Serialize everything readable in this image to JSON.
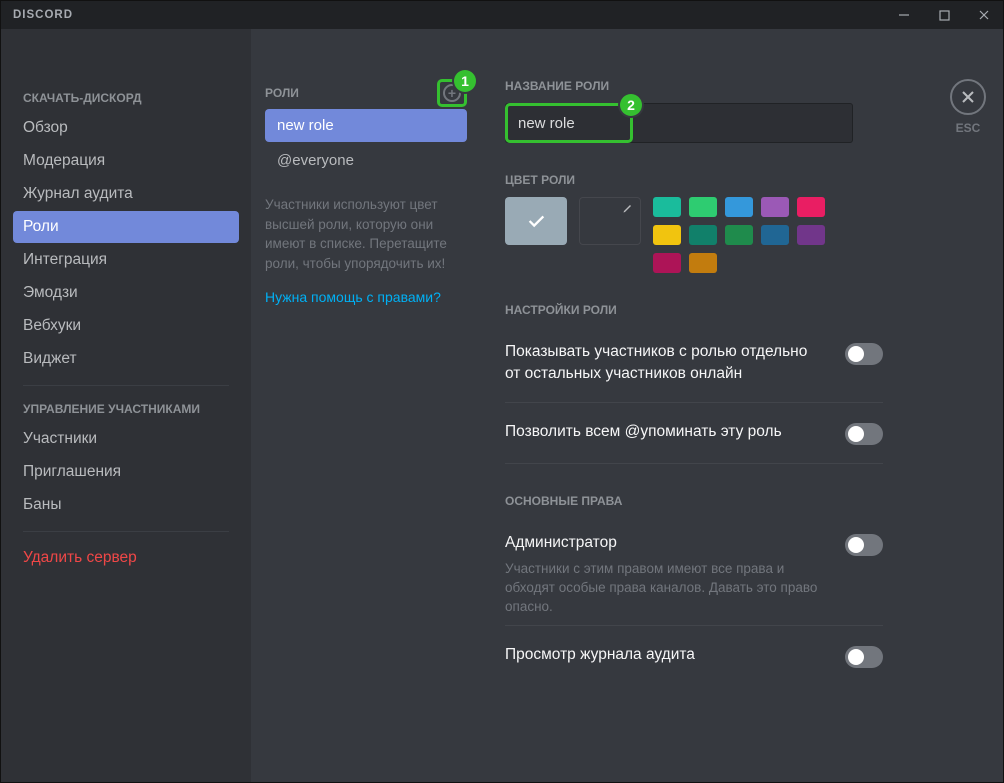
{
  "app": {
    "title": "DISCORD"
  },
  "annotations": {
    "badge1": "1",
    "badge2": "2"
  },
  "close": {
    "esc": "ESC"
  },
  "sidebar": {
    "section1": "СКАЧАТЬ-ДИСКОРД",
    "items1": [
      {
        "label": "Обзор"
      },
      {
        "label": "Модерация"
      },
      {
        "label": "Журнал аудита"
      },
      {
        "label": "Роли",
        "selected": true
      },
      {
        "label": "Интеграция"
      },
      {
        "label": "Эмодзи"
      },
      {
        "label": "Вебхуки"
      },
      {
        "label": "Виджет"
      }
    ],
    "section2": "УПРАВЛЕНИЕ УЧАСТНИКАМИ",
    "items2": [
      {
        "label": "Участники"
      },
      {
        "label": "Приглашения"
      },
      {
        "label": "Баны"
      }
    ],
    "delete": "Удалить сервер"
  },
  "roles": {
    "header": "РОЛИ",
    "list": [
      {
        "label": "new role",
        "selected": true
      },
      {
        "label": "@everyone"
      }
    ],
    "hint": "Участники используют цвет высшей роли, которую они имеют в списке. Перетащите роли, чтобы упорядочить их!",
    "help": "Нужна помощь с правами?"
  },
  "editor": {
    "name_label": "НАЗВАНИЕ РОЛИ",
    "name_value": "new role",
    "color_label": "ЦВЕТ РОЛИ",
    "colors_row1": [
      "#1abc9c",
      "#2ecc71",
      "#3498db",
      "#9b59b6",
      "#e91e63",
      "#f1c40f"
    ],
    "colors_row2": [
      "#11806a",
      "#1f8b4c",
      "#206694",
      "#71368a",
      "#ad1457",
      "#c27c0e"
    ],
    "settings_label": "НАСТРОЙКИ РОЛИ",
    "setting1": "Показывать участников с ролью отдельно от остальных участников онлайн",
    "setting2": "Позволить всем @упоминать эту роль",
    "perms_label": "ОСНОВНЫЕ ПРАВА",
    "perm_admin": "Администратор",
    "perm_admin_desc": "Участники с этим правом имеют все права и обходят особые права каналов. Давать это право опасно.",
    "perm_audit": "Просмотр журнала аудита"
  }
}
